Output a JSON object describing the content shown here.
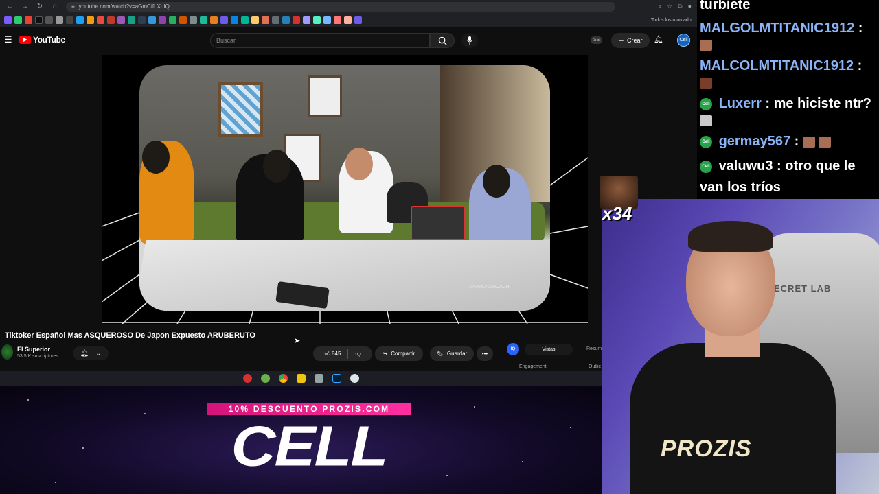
{
  "browser": {
    "url": "youtube.com/watch?v=aGmCffLXufQ",
    "bookmarks_folder": "Todos los marcador"
  },
  "youtube": {
    "logo_text": "YouTube",
    "search_placeholder": "Buscar",
    "create_label": "Crear",
    "header_badge": "SS",
    "avatar_text": "Cell"
  },
  "video": {
    "title": "Tiktoker Español Mas ASQUEROSO De Japon Expuesto ARUBERUTO",
    "watermark": "AAAHCACHCACH",
    "channel_name": "El Superior",
    "channel_subs": "53,5 K suscriptores",
    "like_count": "845",
    "share_label": "Compartir",
    "save_label": "Guardar",
    "more_label": "•••"
  },
  "vidiq": {
    "logo": "IQ",
    "tab_active": "Vistas",
    "tab_other": "Resum",
    "label_left": "Engagement",
    "label_right": "Outlie"
  },
  "banner": {
    "promo": "10% DESCUENTO PROZIS.COM",
    "headline": "CELL"
  },
  "chat": {
    "messages": [
      {
        "name": "",
        "text": "turbiete"
      },
      {
        "name": "MALGOLMTITANIC1912",
        "text": ":"
      },
      {
        "name": "MALCOLMTITANIC1912",
        "text": ":"
      },
      {
        "name": "Luxerr",
        "text": ": me hiciste ntr?"
      },
      {
        "name": "germay567",
        "text": ":"
      },
      {
        "name": "valuwu3",
        "text": ": otro que le"
      },
      {
        "name": "",
        "text": "van los tríos"
      }
    ],
    "badge_text": "Cell",
    "emote_count": "x34"
  },
  "webcam": {
    "chair_text": "ECRET LAB",
    "shirt_text": "PROZIS"
  },
  "colors": {
    "youtube_red": "#ff0000",
    "chat_name": "#8ab4f8",
    "promo_pink": "#ff2fa0",
    "vidiq_blue": "#2962ff"
  }
}
